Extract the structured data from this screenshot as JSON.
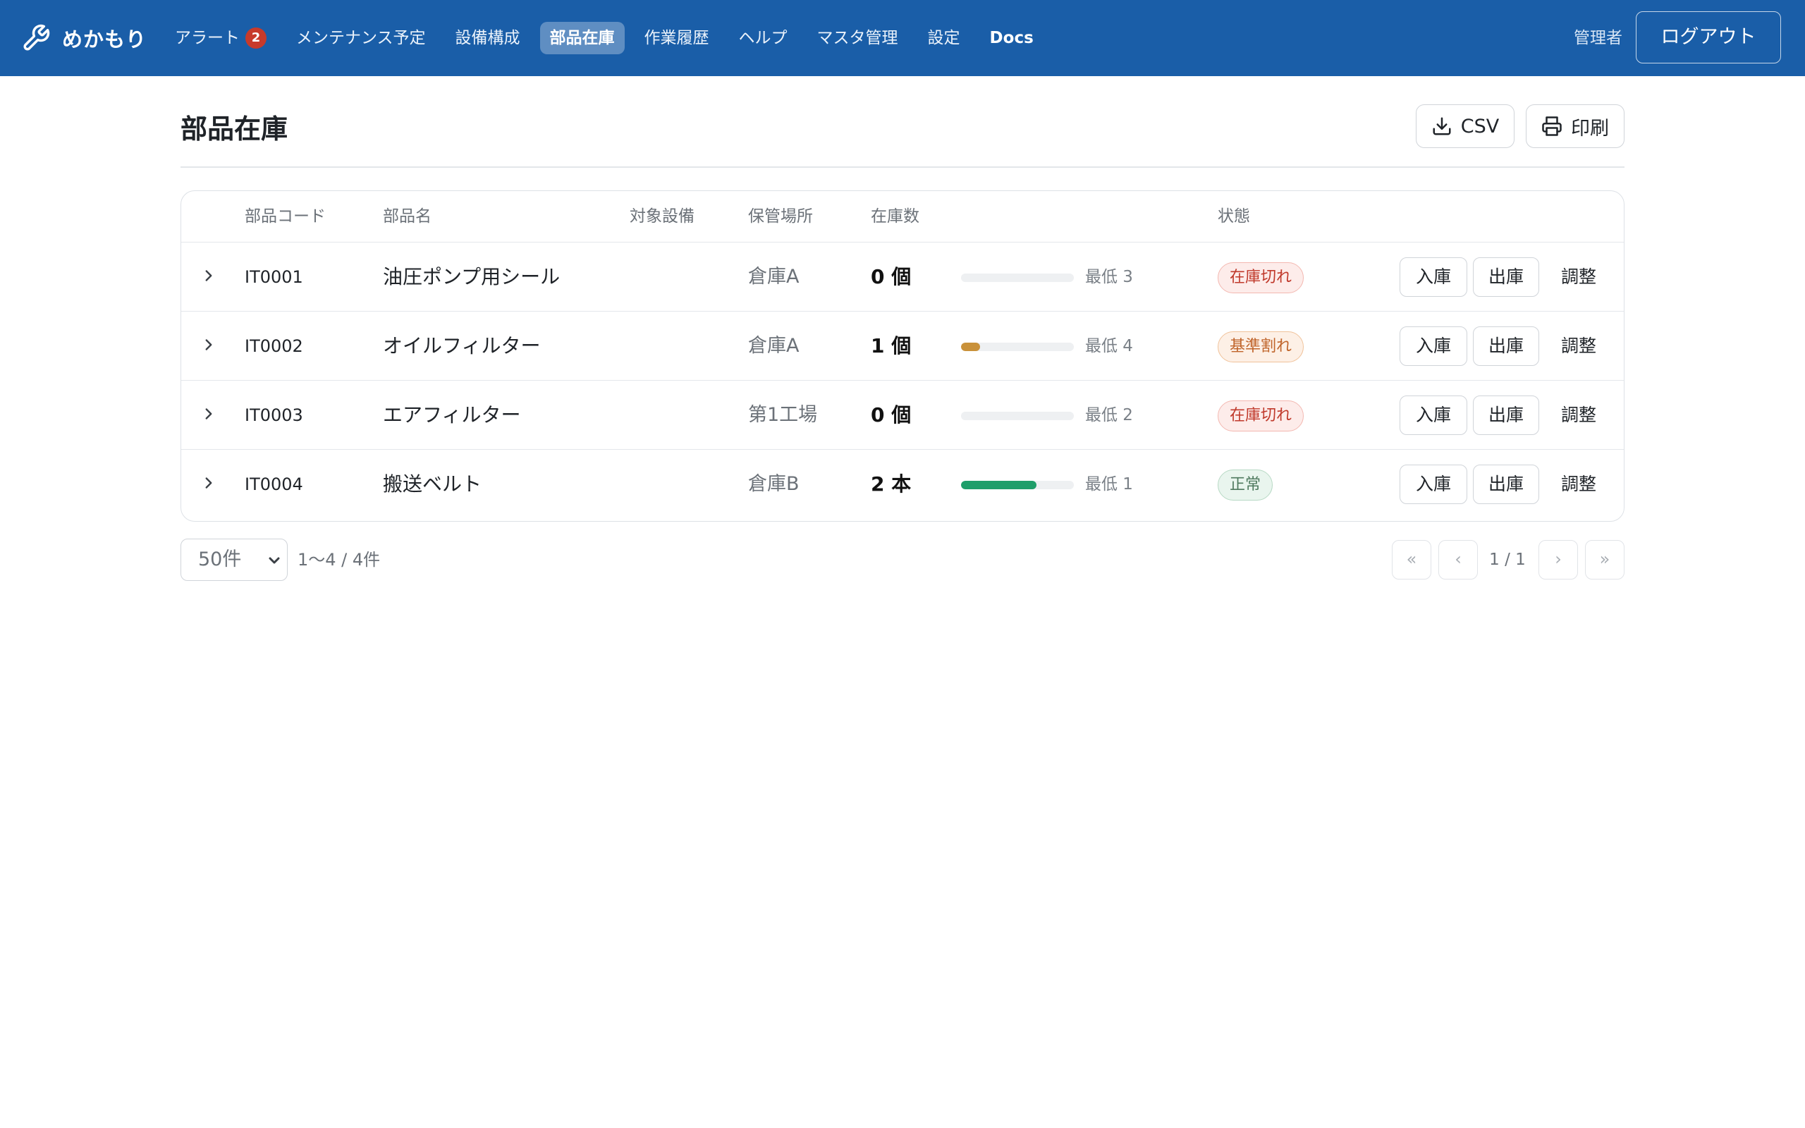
{
  "app": {
    "name": "めかもり",
    "user": "管理者",
    "logout_label": "ログアウト"
  },
  "nav": [
    {
      "label": "アラート",
      "badge": "2"
    },
    {
      "label": "メンテナンス予定"
    },
    {
      "label": "設備構成"
    },
    {
      "label": "部品在庫",
      "active": true
    },
    {
      "label": "作業履歴"
    },
    {
      "label": "ヘルプ"
    },
    {
      "label": "マスタ管理"
    },
    {
      "label": "設定"
    },
    {
      "label": "Docs"
    }
  ],
  "page": {
    "title": "部品在庫",
    "csv_label": "CSV",
    "print_label": "印刷"
  },
  "table": {
    "headers": {
      "code": "部品コード",
      "name": "部品名",
      "equipment": "対象設備",
      "location": "保管場所",
      "qty": "在庫数",
      "status": "状態"
    },
    "rows": [
      {
        "code": "IT0001",
        "name": "油圧ポンプ用シール",
        "equipment": "",
        "location": "倉庫A",
        "qty": "0 個",
        "level": 0,
        "bar_color": "#d0d4d9",
        "min": "最低 3",
        "status": "在庫切れ",
        "status_type": "danger"
      },
      {
        "code": "IT0002",
        "name": "オイルフィルター",
        "equipment": "",
        "location": "倉庫A",
        "qty": "1 個",
        "level": 0.17,
        "bar_color": "#c9913a",
        "min": "最低 4",
        "status": "基準割れ",
        "status_type": "warn"
      },
      {
        "code": "IT0003",
        "name": "エアフィルター",
        "equipment": "",
        "location": "第1工場",
        "qty": "0 個",
        "level": 0,
        "bar_color": "#d0d4d9",
        "min": "最低 2",
        "status": "在庫切れ",
        "status_type": "danger"
      },
      {
        "code": "IT0004",
        "name": "搬送ベルト",
        "equipment": "",
        "location": "倉庫B",
        "qty": "2 本",
        "level": 0.67,
        "bar_color": "#1e9e6a",
        "min": "最低 1",
        "status": "正常",
        "status_type": "ok"
      }
    ],
    "actions": {
      "in": "入庫",
      "out": "出庫",
      "adjust": "調整"
    }
  },
  "footer": {
    "per_page": "50件",
    "count_text": "1〜4 / 4件",
    "page_text": "1 / 1",
    "first": "«",
    "prev": "‹",
    "next": "›",
    "last": "»"
  }
}
